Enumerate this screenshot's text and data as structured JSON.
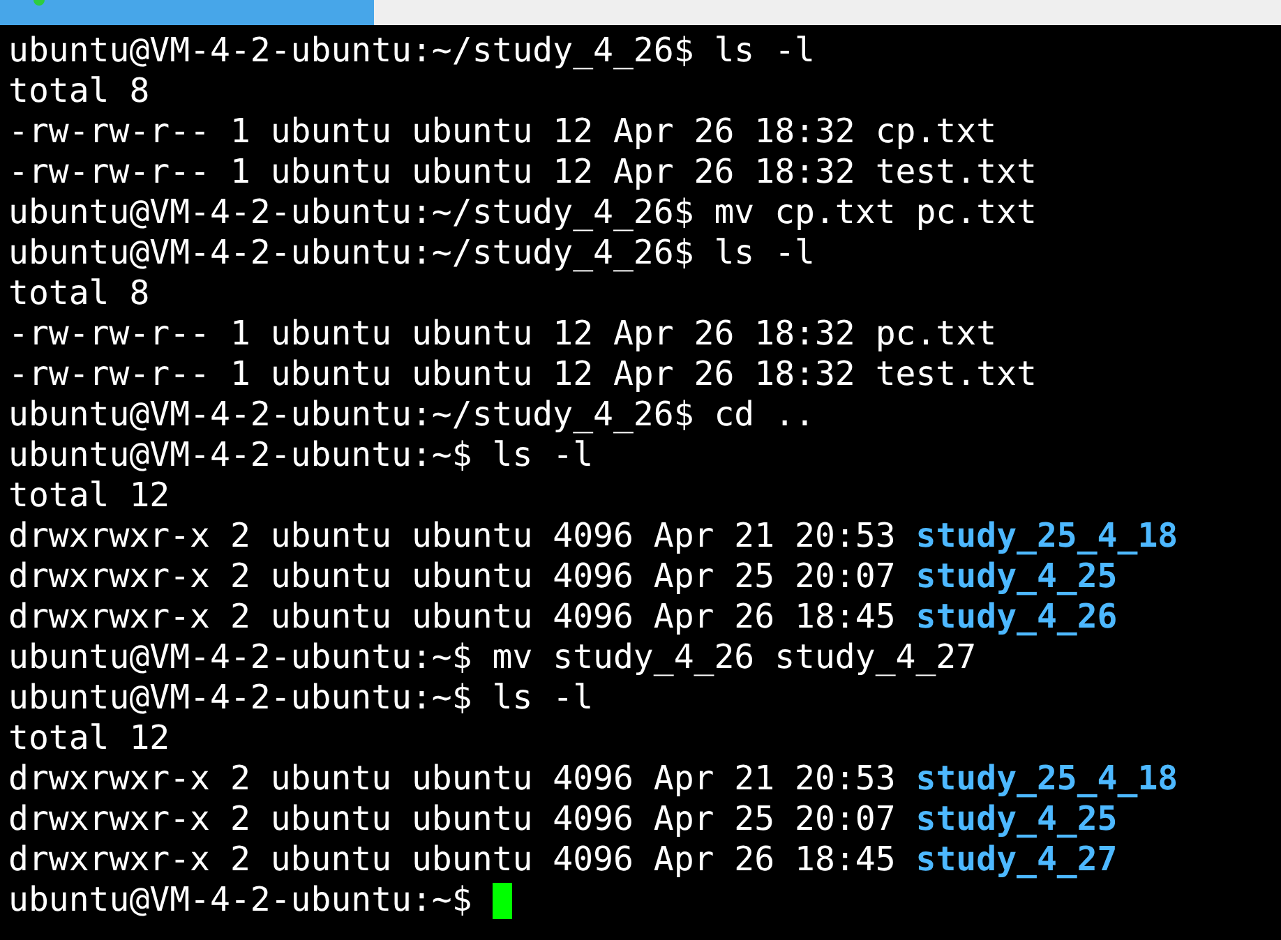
{
  "tab": {
    "active": true
  },
  "lines": [
    {
      "text": "ubuntu@VM-4-2-ubuntu:~/study_4_26$ ls -l"
    },
    {
      "text": "total 8"
    },
    {
      "text": "-rw-rw-r-- 1 ubuntu ubuntu 12 Apr 26 18:32 cp.txt"
    },
    {
      "text": "-rw-rw-r-- 1 ubuntu ubuntu 12 Apr 26 18:32 test.txt"
    },
    {
      "text": "ubuntu@VM-4-2-ubuntu:~/study_4_26$ mv cp.txt pc.txt"
    },
    {
      "text": "ubuntu@VM-4-2-ubuntu:~/study_4_26$ ls -l"
    },
    {
      "text": "total 8"
    },
    {
      "text": "-rw-rw-r-- 1 ubuntu ubuntu 12 Apr 26 18:32 pc.txt"
    },
    {
      "text": "-rw-rw-r-- 1 ubuntu ubuntu 12 Apr 26 18:32 test.txt"
    },
    {
      "text": "ubuntu@VM-4-2-ubuntu:~/study_4_26$ cd .."
    },
    {
      "text": "ubuntu@VM-4-2-ubuntu:~$ ls -l"
    },
    {
      "text": "total 12"
    },
    {
      "text": "drwxrwxr-x 2 ubuntu ubuntu 4096 Apr 21 20:53",
      "directory": "study_25_4_18"
    },
    {
      "text": "drwxrwxr-x 2 ubuntu ubuntu 4096 Apr 25 20:07",
      "directory": "study_4_25"
    },
    {
      "text": "drwxrwxr-x 2 ubuntu ubuntu 4096 Apr 26 18:45",
      "directory": "study_4_26"
    },
    {
      "text": "ubuntu@VM-4-2-ubuntu:~$ mv study_4_26 study_4_27"
    },
    {
      "text": "ubuntu@VM-4-2-ubuntu:~$ ls -l"
    },
    {
      "text": "total 12"
    },
    {
      "text": "drwxrwxr-x 2 ubuntu ubuntu 4096 Apr 21 20:53",
      "directory": "study_25_4_18"
    },
    {
      "text": "drwxrwxr-x 2 ubuntu ubuntu 4096 Apr 25 20:07",
      "directory": "study_4_25"
    },
    {
      "text": "drwxrwxr-x 2 ubuntu ubuntu 4096 Apr 26 18:45",
      "directory": "study_4_27"
    },
    {
      "text": "ubuntu@VM-4-2-ubuntu:~$",
      "cursor": true
    }
  ]
}
